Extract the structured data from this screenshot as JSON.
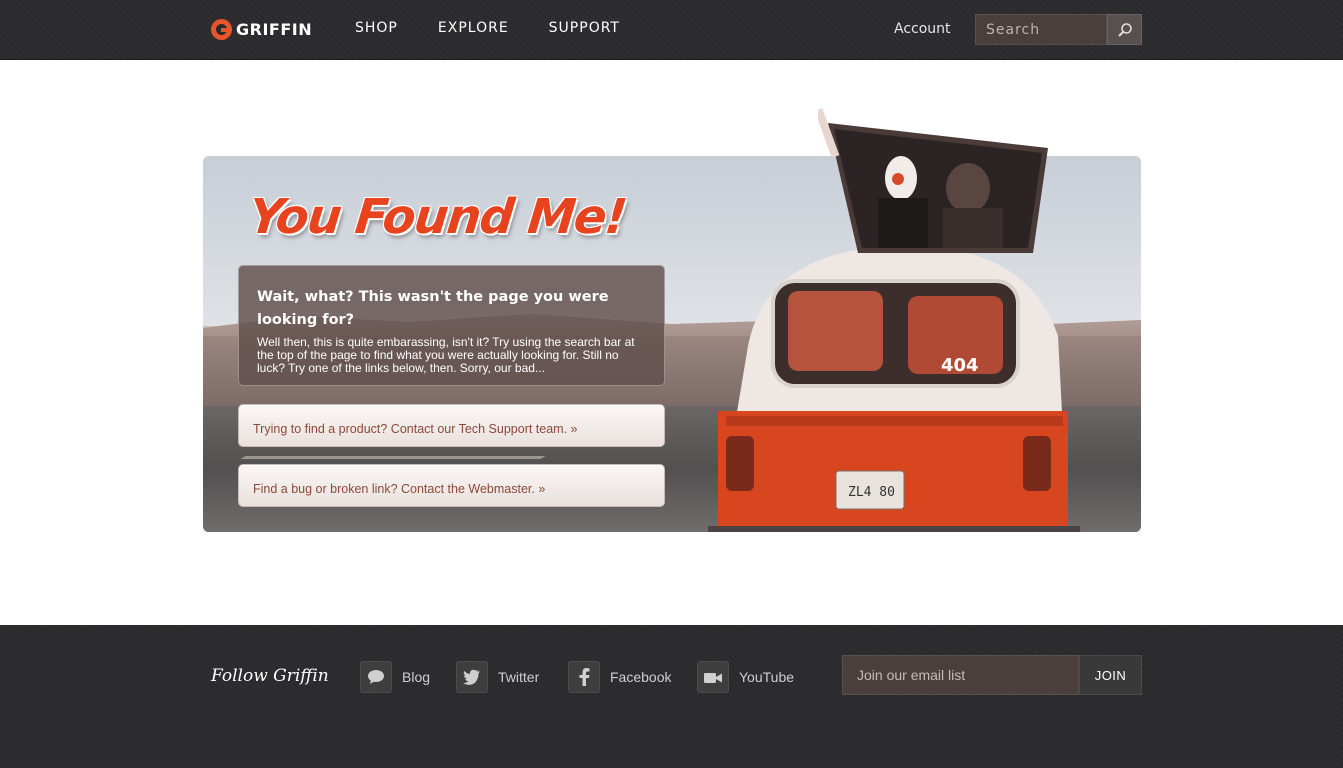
{
  "header": {
    "logo_text": "GRIFFIN",
    "nav": [
      {
        "label": "SHOP"
      },
      {
        "label": "EXPLORE"
      },
      {
        "label": "SUPPORT"
      }
    ],
    "account_label": "Account",
    "search": {
      "placeholder": "Search",
      "icon": "search-icon"
    }
  },
  "hero": {
    "title": "You Found Me!",
    "message_title": "Wait, what? This wasn't the page you were looking for?",
    "message_body": "Well then, this is quite embarassing, isn't it? Try using the search bar at the top of the page to find what you were actually looking for. Still no luck? Try one of the links below, then. Sorry, our bad...",
    "links": [
      {
        "label": "Trying to find a product? Contact our Tech Support team. »"
      },
      {
        "label": "Find a bug or broken link? Contact the Webmaster. »"
      }
    ],
    "van_plate": "404"
  },
  "footer": {
    "follow_label": "Follow Griffin",
    "social": [
      {
        "label": "Blog",
        "icon": "speech-bubble-icon"
      },
      {
        "label": "Twitter",
        "icon": "twitter-bird-icon"
      },
      {
        "label": "Facebook",
        "icon": "facebook-icon"
      },
      {
        "label": "YouTube",
        "icon": "video-camera-icon"
      }
    ],
    "email": {
      "placeholder": "Join our email list",
      "button_label": "JOIN"
    }
  },
  "colors": {
    "accent": "#e8552b",
    "header_bg": "#2a2a2c",
    "title_red": "#e8431f",
    "van_orange": "#d7461f"
  }
}
